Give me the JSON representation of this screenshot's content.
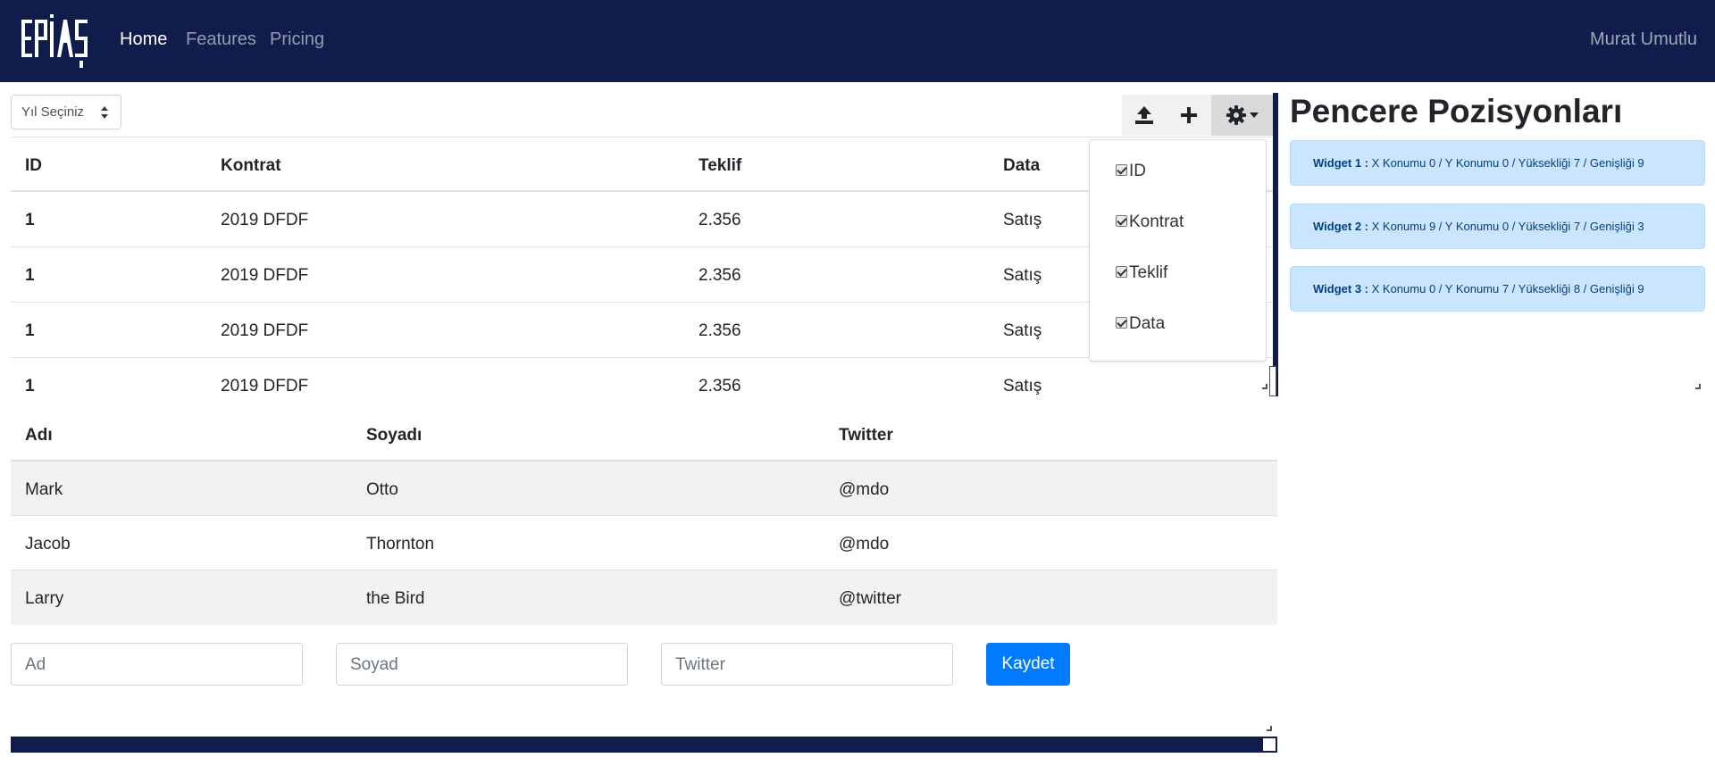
{
  "navbar": {
    "brand": "EPİAŞ",
    "links": [
      {
        "label": "Home",
        "active": true
      },
      {
        "label": "Features",
        "active": false
      },
      {
        "label": "Pricing",
        "active": false
      }
    ],
    "user": "Murat Umutlu",
    "background": "#101d4c"
  },
  "year_select": {
    "label": "Yıl Seçiniz"
  },
  "toolbar": {
    "icons": [
      "upload-icon",
      "plus-icon",
      "gear-icon",
      "caret-down-icon"
    ]
  },
  "columns_dropdown": {
    "items": [
      {
        "label": "ID",
        "checked": true
      },
      {
        "label": "Kontrat",
        "checked": true
      },
      {
        "label": "Teklif",
        "checked": true
      },
      {
        "label": "Data",
        "checked": true
      }
    ]
  },
  "contract_table": {
    "headers": [
      "ID",
      "Kontrat",
      "Teklif",
      "Data"
    ],
    "rows": [
      [
        "1",
        "2019 DFDF",
        "2.356",
        "Satış"
      ],
      [
        "1",
        "2019 DFDF",
        "2.356",
        "Satış"
      ],
      [
        "1",
        "2019 DFDF",
        "2.356",
        "Satış"
      ],
      [
        "1",
        "2019 DFDF",
        "2.356",
        "Satış"
      ]
    ]
  },
  "people_table": {
    "headers": [
      "Adı",
      "Soyadı",
      "Twitter"
    ],
    "rows": [
      [
        "Mark",
        "Otto",
        "@mdo"
      ],
      [
        "Jacob",
        "Thornton",
        "@mdo"
      ],
      [
        "Larry",
        "the Bird",
        "@twitter"
      ]
    ]
  },
  "form": {
    "first_name_placeholder": "Ad",
    "last_name_placeholder": "Soyad",
    "twitter_placeholder": "Twitter",
    "submit_label": "Kaydet",
    "accent": "#007bff"
  },
  "positions_panel": {
    "title": "Pencere Pozisyonları",
    "widgets": [
      {
        "name": "Widget 1 :",
        "info": "X Konumu 0 / Y Konumu 0 / Yüksekliği 7 / Genişliği 9"
      },
      {
        "name": "Widget 2 :",
        "info": "X Konumu 9 / Y Konumu 0 / Yüksekliği 7 / Genişliği 3"
      },
      {
        "name": "Widget 3 :",
        "info": "X Konumu 0 / Y Konumu 7 / Yüksekliği 8 / Genişliği 9"
      }
    ]
  }
}
